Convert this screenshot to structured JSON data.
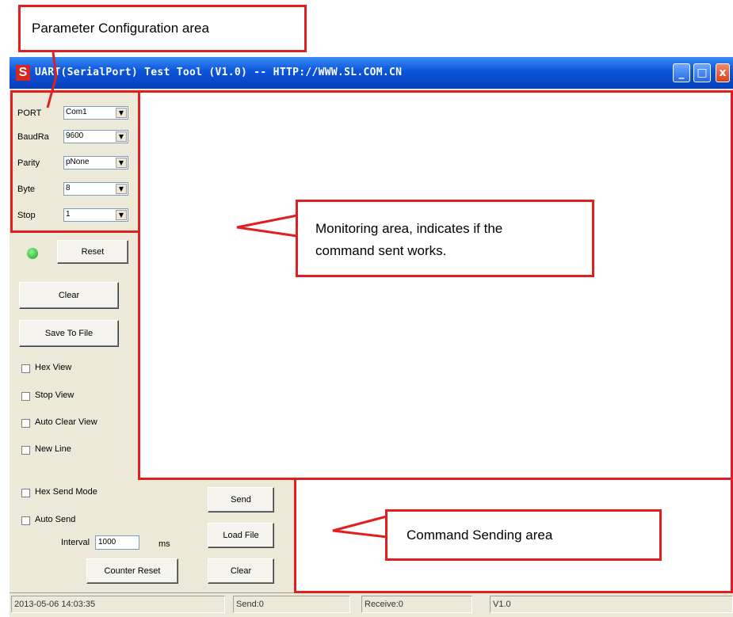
{
  "window": {
    "title": "UART(SerialPort) Test Tool (V1.0) -- HTTP://WWW.SL.COM.CN",
    "app_icon_letter": "S",
    "minimize_glyph": "_",
    "maximize_glyph": "□",
    "close_glyph": "x"
  },
  "params": {
    "port_label": "PORT",
    "port_value": "Com1",
    "baud_label": "BaudRa",
    "baud_value": "9600",
    "parity_label": "Parity",
    "parity_value": "pNone",
    "byte_label": "Byte",
    "byte_value": "8",
    "stop_label": "Stop",
    "stop_value": "1",
    "dropdown_glyph": "▼"
  },
  "controls": {
    "reset_label": "Reset",
    "clear_label": "Clear",
    "save_label": "Save To File",
    "hex_view_label": "Hex View",
    "stop_view_label": "Stop View",
    "auto_clear_label": "Auto Clear View",
    "new_line_label": "New Line"
  },
  "send": {
    "hex_send_label": "Hex Send Mode",
    "auto_send_label": "Auto Send",
    "interval_label": "Interval",
    "interval_value": "1000",
    "interval_unit": "ms",
    "counter_reset_label": "Counter Reset",
    "send_label": "Send",
    "load_file_label": "Load File",
    "clear_label": "Clear"
  },
  "status": {
    "datetime": "2013-05-06 14:03:35",
    "send": "Send:0",
    "receive": "Receive:0",
    "version": "V1.0"
  },
  "annotations": {
    "param_area": "Parameter Configuration area",
    "monitor_line1": "Monitoring area, indicates if the",
    "monitor_line2": "command sent works.",
    "send_area": "Command Sending area"
  },
  "colors": {
    "annotation_red": "#e02020",
    "titlebar_blue": "#0a54d9",
    "led_green": "#1aa51a"
  },
  "icons": [
    "app-icon",
    "minimize-icon",
    "maximize-icon",
    "close-icon",
    "dropdown-arrow-icon",
    "status-led-icon"
  ]
}
